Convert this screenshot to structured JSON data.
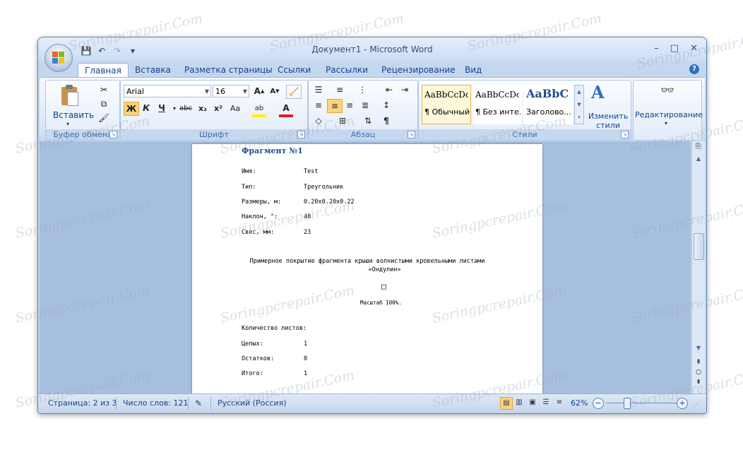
{
  "window": {
    "title": "Документ1 - Microsoft Word",
    "controls": {
      "minimize": "–",
      "maximize": "□",
      "close": "✕"
    }
  },
  "quick_access": {
    "save": "💾",
    "undo": "↶",
    "redo": "↷",
    "more": "▾"
  },
  "tabs": [
    "Главная",
    "Вставка",
    "Разметка страницы",
    "Ссылки",
    "Рассылки",
    "Рецензирование",
    "Вид"
  ],
  "active_tab": 0,
  "ribbon": {
    "clipboard": {
      "label": "Буфер обмена",
      "paste": "Вставить"
    },
    "font": {
      "label": "Шрифт",
      "font_name": "Arial",
      "font_size": "16",
      "grow": "A",
      "shrink": "A",
      "clear": "🧹",
      "bold": "Ж",
      "italic": "К",
      "underline": "Ч",
      "strike": "abc",
      "subscript": "x₂",
      "superscript": "x²",
      "case": "Aa",
      "highlight": "ab",
      "color": "A"
    },
    "paragraph": {
      "label": "Абзац"
    },
    "styles": {
      "label": "Стили",
      "items": [
        {
          "sample": "AaBbCcDc",
          "name": "¶ Обычный"
        },
        {
          "sample": "AaBbCcDc",
          "name": "¶ Без инте..."
        },
        {
          "sample": "AaBbC",
          "name": "Заголово..."
        }
      ],
      "change": "Изменить стили"
    },
    "editing": {
      "label": "Редактирование"
    }
  },
  "document": {
    "heading": "Фрагмент №1",
    "fields": [
      {
        "label": "Имя:",
        "value": "Test"
      },
      {
        "label": "Тип:",
        "value": "Треугольник"
      },
      {
        "label": "Размеры, м:",
        "value": "0.20x0.20x0.22"
      },
      {
        "label": "Наклон, °:",
        "value": "40"
      },
      {
        "label": "Свес, мм:",
        "value": "23"
      }
    ],
    "coverage_line1": "Примерное покрытие фрагмента крыши волнистыми кровельными листами",
    "coverage_line2": "«Ондулин»",
    "marker": "□",
    "scale": "Масштаб 100%.",
    "sheets_title": "Количество листов:",
    "sheets": [
      {
        "label": "Целых:",
        "value": "1"
      },
      {
        "label": "Остатков:",
        "value": "0"
      },
      {
        "label": "Итого:",
        "value": "1"
      }
    ]
  },
  "status": {
    "page": "Страница: 2 из 3",
    "words": "Число слов: 121",
    "language": "Русский (Россия)",
    "zoom": "62%",
    "zoom_level": 0.62
  },
  "watermark": "Soringpcrepair.Com"
}
